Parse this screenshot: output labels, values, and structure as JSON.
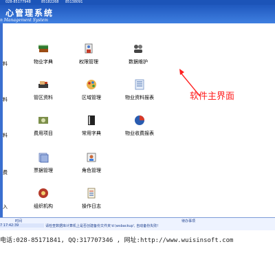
{
  "titlebar": {
    "phones": [
      "028-85177948",
      "85182268",
      "85138091"
    ]
  },
  "header": {
    "title": "心管理系统",
    "subtitle": "n Management System"
  },
  "tiles": [
    {
      "id": "tile-1",
      "label": "物业字典"
    },
    {
      "id": "tile-2",
      "label": "权限管理"
    },
    {
      "id": "tile-3",
      "label": "数据维护"
    },
    {
      "id": "tile-4",
      "label": "管区资料"
    },
    {
      "id": "tile-5",
      "label": "区域管理"
    },
    {
      "id": "tile-6",
      "label": "物业资料报表"
    },
    {
      "id": "tile-7",
      "label": "费用项目"
    },
    {
      "id": "tile-8",
      "label": "常用字典"
    },
    {
      "id": "tile-9",
      "label": "物业收费报表"
    },
    {
      "id": "tile-10",
      "label": "票据管理"
    },
    {
      "id": "tile-11",
      "label": "角色管理"
    },
    {
      "id": "tile-12",
      "label": "组织机构"
    },
    {
      "id": "tile-13",
      "label": "操作日志"
    }
  ],
  "left_stubs": [
    "料",
    "料",
    "料",
    "费",
    "入"
  ],
  "callout": "软件主界面",
  "statusbar": {
    "col_time": "时间",
    "col_task": "待办事项",
    "time": "7 17:42:39",
    "message": "请检查数据库计算机上是否创建备份文件夹'd:\\wsbackup', 自动备份失败!"
  },
  "contact": "电话:028-85171841, QQ:317707346 , 网址:http://www.wuisinsoft.com",
  "colors": {
    "header": "#1f58be",
    "callout": "#ff2020",
    "accent": "#3f7fe0"
  }
}
